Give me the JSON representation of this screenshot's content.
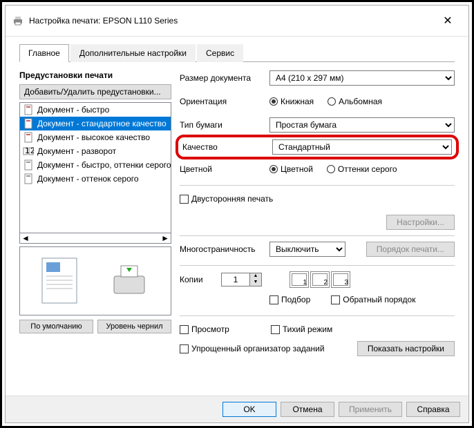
{
  "window": {
    "title": "Настройка печати: EPSON L110 Series"
  },
  "tabs": {
    "main": "Главное",
    "advanced": "Дополнительные настройки",
    "service": "Сервис"
  },
  "presets": {
    "title": "Предустановки печати",
    "add_remove": "Добавить/Удалить предустановки...",
    "items": [
      "Документ - быстро",
      "Документ - стандартное качество",
      "Документ - высокое качество",
      "Документ - разворот",
      "Документ - быстро, оттенки серого",
      "Документ - оттенок серого"
    ],
    "default_btn": "По умолчанию",
    "ink_btn": "Уровень чернил"
  },
  "settings": {
    "doc_size_label": "Размер документа",
    "doc_size_value": "A4 (210 x 297 мм)",
    "orientation_label": "Ориентация",
    "portrait": "Книжная",
    "landscape": "Альбомная",
    "paper_type_label": "Тип бумаги",
    "paper_type_value": "Простая бумага",
    "quality_label": "Качество",
    "quality_value": "Стандартный",
    "color_label": "Цветной",
    "color_color": "Цветной",
    "color_gray": "Оттенки серого",
    "duplex": "Двусторонняя печать",
    "duplex_settings": "Настройки...",
    "multipage_label": "Многостраничность",
    "multipage_value": "Выключить",
    "page_order": "Порядок печати...",
    "copies_label": "Копии",
    "copies_value": "1",
    "collate": "Подбор",
    "reverse": "Обратный порядок",
    "preview": "Просмотр",
    "quiet": "Тихий режим",
    "job_organizer": "Упрощенный организатор заданий",
    "show_settings": "Показать настройки"
  },
  "footer": {
    "ok": "OK",
    "cancel": "Отмена",
    "apply": "Применить",
    "help": "Справка"
  }
}
